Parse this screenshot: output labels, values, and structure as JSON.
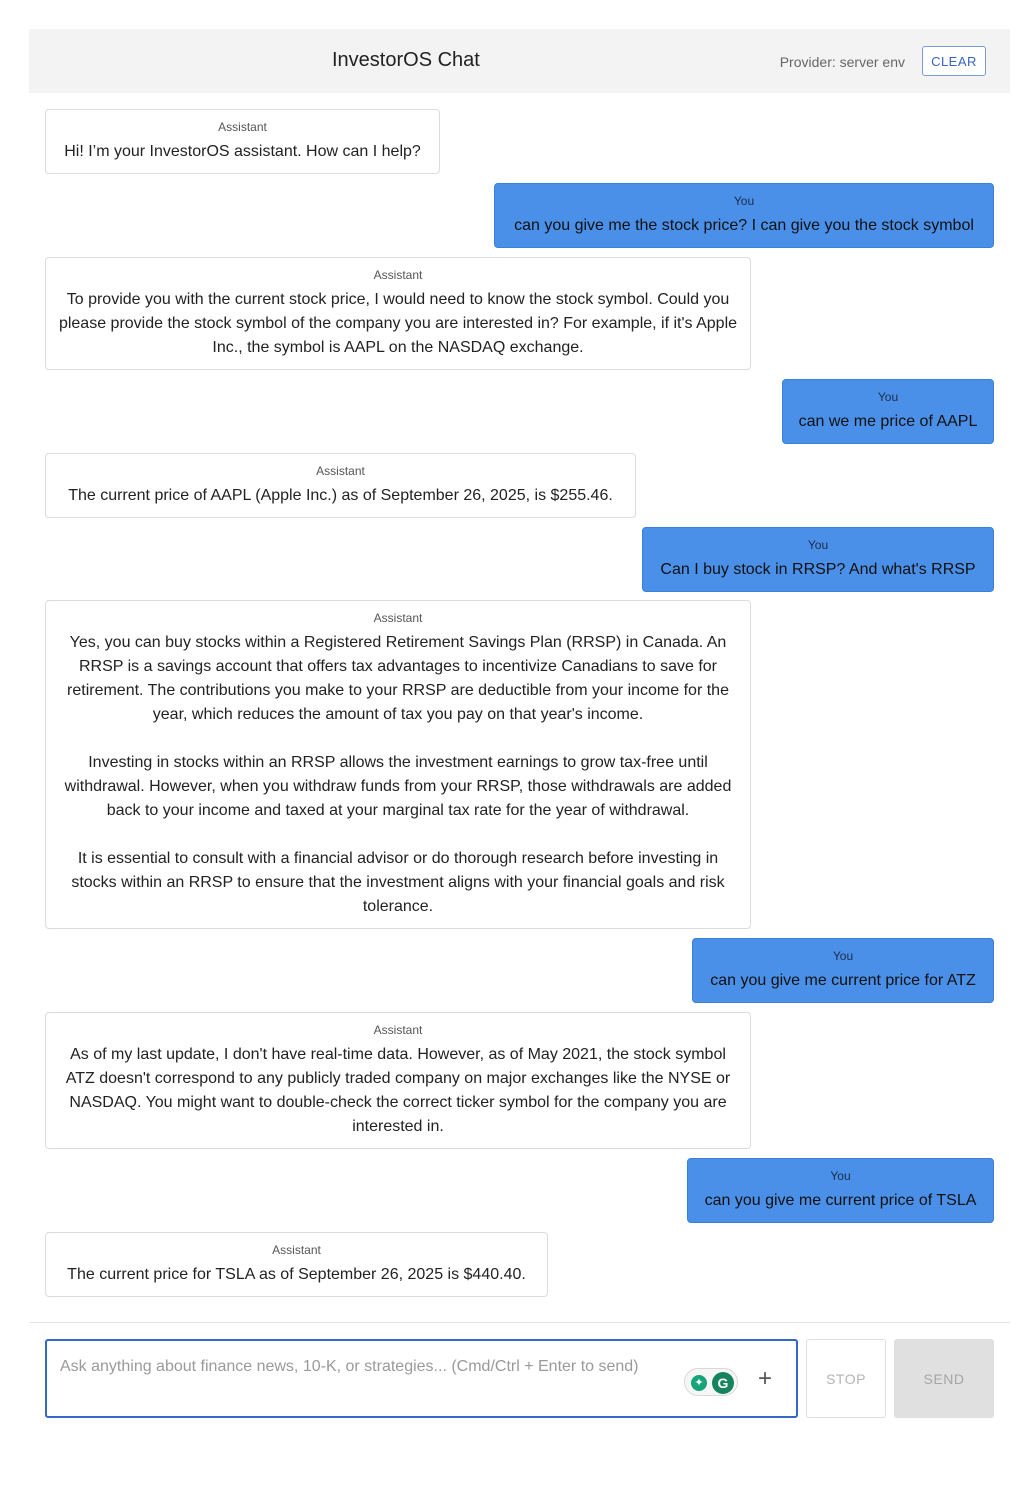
{
  "header": {
    "title": "InvestorOS Chat",
    "provider": "Provider: server env",
    "clear_label": "CLEAR"
  },
  "messages": [
    {
      "role": "Assistant",
      "text": "Hi! I’m your InvestorOS assistant. How can I help?"
    },
    {
      "role": "You",
      "text": "can you give me the stock price? I can give you the stock symbol"
    },
    {
      "role": "Assistant",
      "text": "To provide you with the current stock price, I would need to know the stock symbol. Could you please provide the stock symbol of the company you are interested in? For example, if it's Apple Inc., the symbol is AAPL on the NASDAQ exchange."
    },
    {
      "role": "You",
      "text": "can we me price of AAPL"
    },
    {
      "role": "Assistant",
      "text": "The current price of AAPL (Apple Inc.) as of September 26, 2025, is $255.46."
    },
    {
      "role": "You",
      "text": "Can I buy stock in RRSP? And what's RRSP"
    },
    {
      "role": "Assistant",
      "text": "Yes, you can buy stocks within a Registered Retirement Savings Plan (RRSP) in Canada. An RRSP is a savings account that offers tax advantages to incentivize Canadians to save for retirement. The contributions you make to your RRSP are deductible from your income for the year, which reduces the amount of tax you pay on that year's income.\n\nInvesting in stocks within an RRSP allows the investment earnings to grow tax-free until withdrawal. However, when you withdraw funds from your RRSP, those withdrawals are added back to your income and taxed at your marginal tax rate for the year of withdrawal.\n\nIt is essential to consult with a financial advisor or do thorough research before investing in stocks within an RRSP to ensure that the investment aligns with your financial goals and risk tolerance."
    },
    {
      "role": "You",
      "text": "can you give me current price for ATZ"
    },
    {
      "role": "Assistant",
      "text": "As of my last update, I don't have real-time data. However, as of May 2021, the stock symbol ATZ doesn't correspond to any publicly traded company on major exchanges like the NYSE or NASDAQ. You might want to double-check the correct ticker symbol for the company you are interested in."
    },
    {
      "role": "You",
      "text": "can you give me current price of TSLA"
    },
    {
      "role": "Assistant",
      "text": "The current price for TSLA as of September 26, 2025 is $440.40."
    }
  ],
  "composer": {
    "placeholder": "Ask anything about finance news, 10-K, or strategies... (Cmd/Ctrl + Enter to send)",
    "plus_label": "+",
    "stop_label": "STOP",
    "send_label": "SEND",
    "extension_icon": "grammarly-icon"
  },
  "colors": {
    "user_bubble": "#4a90e8",
    "accent": "#3467c6",
    "header_bg": "#f3f3f3"
  }
}
